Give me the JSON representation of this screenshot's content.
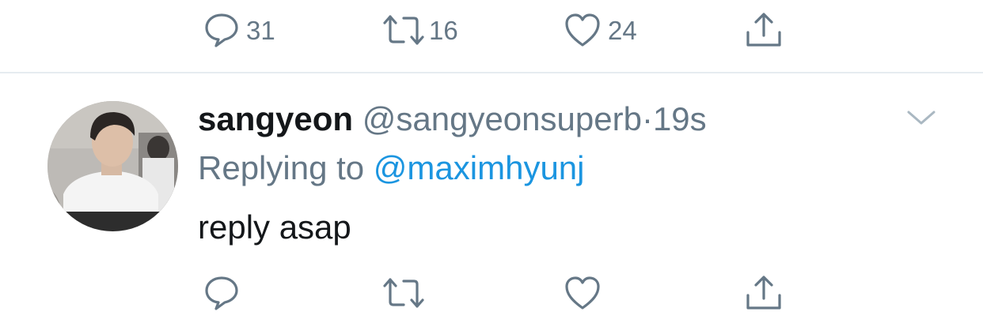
{
  "top_actions": {
    "reply_count": "31",
    "retweet_count": "16",
    "like_count": "24"
  },
  "tweet": {
    "display_name": "sangyeon",
    "handle": "@sangyeonsuperb",
    "separator": "·",
    "time": "19s",
    "replying_prefix": "Replying to",
    "replying_to": "@maximhyunj",
    "text": "reply asap"
  },
  "colors": {
    "icon_gray": "#657786",
    "link_blue": "#1b95e0",
    "text_dark": "#14171a",
    "divider": "#e6ecf0"
  },
  "icons": {
    "reply": "speech-bubble-icon",
    "retweet": "retweet-arrows-icon",
    "like": "heart-icon",
    "share": "share-upload-icon",
    "more": "chevron-down-icon"
  }
}
